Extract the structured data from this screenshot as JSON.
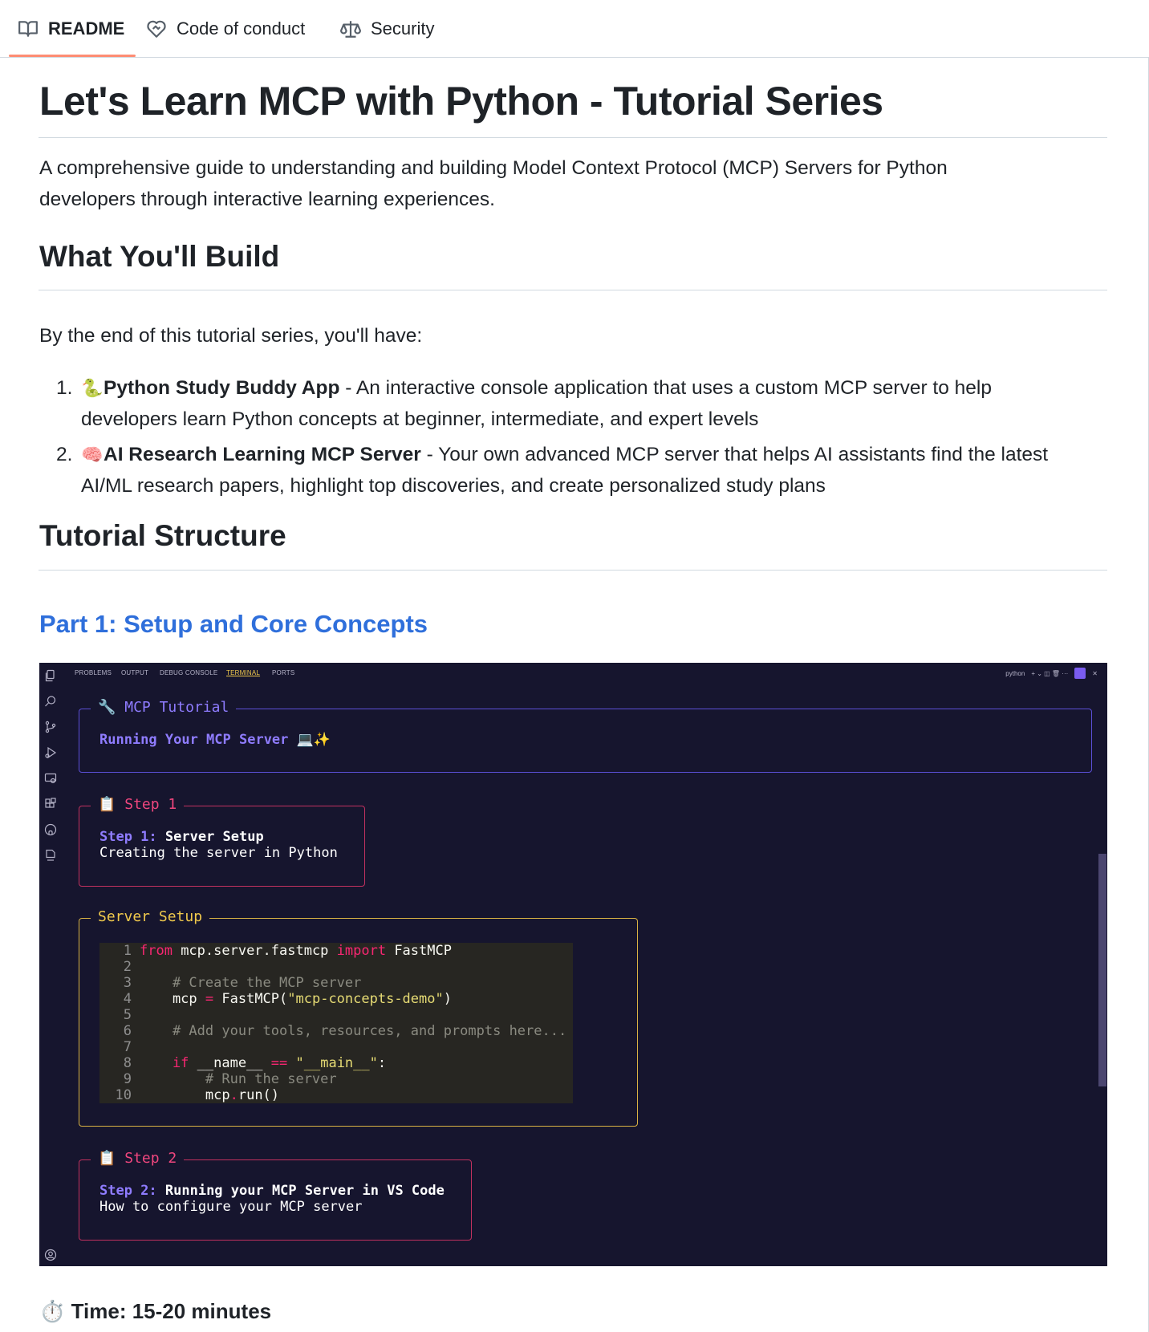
{
  "tabs": [
    {
      "label": "README",
      "icon": "book-icon",
      "active": true
    },
    {
      "label": "Code of conduct",
      "icon": "heart-handshake-icon",
      "active": false
    },
    {
      "label": "Security",
      "icon": "law-scale-icon",
      "active": false
    }
  ],
  "readme": {
    "title": "Let's Learn MCP with Python - Tutorial Series",
    "intro_line1": "A comprehensive guide to understanding and building Model Context Protocol (MCP) Servers for Python",
    "intro_line2": "developers through interactive learning experiences.",
    "build_heading": "What You'll Build",
    "build_intro": "By the end of this tutorial series, you'll have:",
    "build_items": [
      {
        "number": "1.",
        "emoji": "🐍",
        "name": "Python Study Buddy App",
        "desc_line1": " - An interactive console application that uses a custom MCP server to help",
        "desc_line2": "developers learn Python concepts at beginner, intermediate, and expert levels"
      },
      {
        "number": "2.",
        "emoji": "🧠",
        "name": "AI Research Learning MCP Server",
        "desc_line1": " - Your own advanced MCP server that helps AI assistants find the latest",
        "desc_line2": "AI/ML research papers, highlight top discoveries, and create personalized study plans"
      }
    ],
    "structure_heading": "Tutorial Structure",
    "part1_heading": "Part 1: Setup and Core Concepts",
    "time_emoji": "⏱️",
    "time_label": "Time: 15-20 minutes"
  },
  "terminal": {
    "panel_tabs": [
      "PROBLEMS",
      "OUTPUT",
      "DEBUG CONSOLE",
      "TERMINAL",
      "PORTS"
    ],
    "active_tab": "TERMINAL",
    "shell_label": "python",
    "right_controls": "+ ⌄  ◫  🗑  ···",
    "close": "✕",
    "box1": {
      "title": "🔧 MCP Tutorial",
      "line": "Running Your MCP Server",
      "line_suffix": " 💻✨"
    },
    "step1": {
      "title": "📋 Step 1",
      "line1_a": "Step 1:",
      "line1_b": " Server Setup",
      "line2": "Creating the server in Python"
    },
    "server_setup": {
      "title": "Server Setup",
      "code": [
        {
          "n": "1",
          "parts": [
            [
              "kw",
              "from"
            ],
            [
              "fn",
              " mcp.server.fastmcp "
            ],
            [
              "kw",
              "import"
            ],
            [
              "fn",
              " FastMCP"
            ]
          ]
        },
        {
          "n": "2",
          "parts": []
        },
        {
          "n": "3",
          "parts": [
            [
              "cm",
              "    # Create the MCP server"
            ]
          ]
        },
        {
          "n": "4",
          "parts": [
            [
              "fn",
              "    mcp "
            ],
            [
              "kw",
              "="
            ],
            [
              "fn",
              " FastMCP("
            ],
            [
              "str",
              "\"mcp-concepts-demo\""
            ],
            [
              "fn",
              ")"
            ]
          ]
        },
        {
          "n": "5",
          "parts": []
        },
        {
          "n": "6",
          "parts": [
            [
              "cm",
              "    # Add your tools, resources, and prompts here..."
            ]
          ]
        },
        {
          "n": "7",
          "parts": []
        },
        {
          "n": "8",
          "parts": [
            [
              "kw",
              "    if"
            ],
            [
              "fn",
              " __name__ "
            ],
            [
              "kw",
              "=="
            ],
            [
              "fn",
              " "
            ],
            [
              "str",
              "\"__main__\""
            ],
            [
              "fn",
              ":"
            ]
          ]
        },
        {
          "n": "9",
          "parts": [
            [
              "cm",
              "        # Run the server"
            ]
          ]
        },
        {
          "n": "10",
          "parts": [
            [
              "fn",
              "        mcp"
            ],
            [
              "kw",
              "."
            ],
            [
              "fn",
              "run()"
            ]
          ]
        }
      ]
    },
    "step2": {
      "title": "📋 Step 2",
      "line1_a": "Step 2:",
      "line1_b": " Running your MCP Server in VS Code",
      "line2": "How to configure your MCP server"
    },
    "colors": {
      "background": "#16152e",
      "box1_border": "#5b4fd6",
      "step_border": "#c2315f",
      "step_title": "#f0467e",
      "server_border": "#d9b243",
      "server_title": "#f0c94c",
      "accent_purple": "#8f7cff"
    }
  }
}
